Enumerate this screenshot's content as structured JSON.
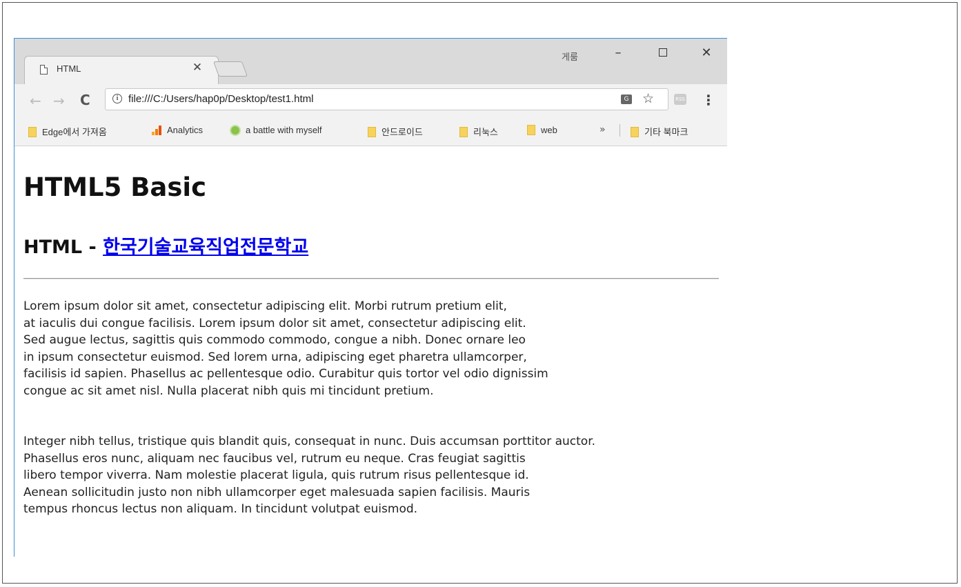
{
  "window": {
    "user_label": "게룸",
    "minimize_label": "–",
    "close_label": "✕"
  },
  "tab": {
    "title": "HTML",
    "close_label": "✕"
  },
  "toolbar": {
    "back_label": "←",
    "forward_label": "→",
    "reload_label": "C",
    "url": "file:///C:/Users/hap0p/Desktop/test1.html",
    "star_label": "☆",
    "menu_label": "⋮"
  },
  "bookmarks": {
    "items": [
      {
        "label": "Edge에서 가져옴",
        "icon": "folder-icon"
      },
      {
        "label": "Analytics",
        "icon": "analytics-icon"
      },
      {
        "label": "a battle with myself",
        "icon": "globe-icon"
      },
      {
        "label": "안드로이드",
        "icon": "folder-icon"
      },
      {
        "label": "리눅스",
        "icon": "folder-icon"
      },
      {
        "label": "web",
        "icon": "folder-icon"
      }
    ],
    "more_label": "»",
    "other_label": "기타 북마크"
  },
  "page": {
    "heading": "HTML5 Basic",
    "subheading_prefix": "HTML - ",
    "subheading_link": "한국기술교육직업전문학교",
    "paragraph1_lines": [
      "Lorem ipsum dolor sit amet, consectetur adipiscing elit. Morbi rutrum pretium elit,",
      "at iaculis dui congue facilisis. Lorem ipsum dolor sit amet, consectetur adipiscing elit.",
      "Sed augue lectus, sagittis quis commodo commodo, congue a nibh. Donec ornare leo",
      "in ipsum consectetur euismod. Sed lorem urna, adipiscing eget pharetra ullamcorper,",
      "facilisis id sapien. Phasellus ac pellentesque odio. Curabitur quis tortor vel odio dignissim",
      "congue ac sit amet nisl. Nulla placerat nibh quis mi tincidunt pretium."
    ],
    "paragraph2_lines": [
      "Integer nibh tellus, tristique quis blandit quis, consequat in nunc. Duis accumsan porttitor auctor.",
      "Phasellus eros nunc, aliquam nec faucibus vel, rutrum eu neque. Cras feugiat sagittis",
      "libero tempor viverra. Nam molestie placerat ligula, quis rutrum risus pellentesque id.",
      "Aenean sollicitudin justo non nibh ullamcorper eget malesuada sapien facilisis. Mauris",
      "tempus rhoncus lectus non aliquam. In tincidunt volutpat euismod."
    ]
  },
  "colors": {
    "link": "#0000ee",
    "frame_accent": "#3c8fd6",
    "titlebar": "#dadada",
    "folder": "#f7d35d"
  }
}
